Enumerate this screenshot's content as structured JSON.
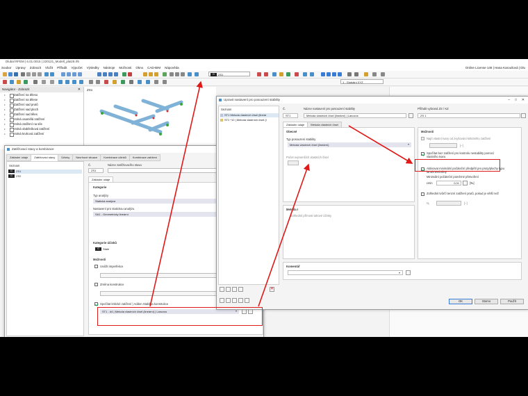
{
  "app": {
    "title": "Dlubal RFEM | 6.01.0015 | 220121_Modell_platz8.rf6",
    "license": "Online License 146 | Hana Karoušová | Dlu",
    "menu": [
      "Soubor",
      "Úpravy",
      "Zobrazit",
      "Vložit",
      "Přiřadit",
      "Výpočet",
      "Výsledky",
      "Nástroje",
      "Možnosti",
      "Okno",
      "CAD-BIM",
      "Nápověda"
    ],
    "toolbar": {
      "loadcase_swatch": "G",
      "loadcase": "ZS1",
      "coord_system": "1 - Globální XYZ"
    }
  },
  "navigator": {
    "title": "Navigátor - Zobrazit",
    "items": [
      "Zatížení na těleso",
      "Zatížení na tělese",
      "Zatížení sad prutů",
      "Zatížení sad ploch",
      "Zatížení sad těles",
      "Volná osamělá zatížení",
      "Volná zatížení na síle",
      "Volná obdélníková zatížení",
      "Volná kruhová zatížení"
    ]
  },
  "viewport": {
    "label": "ZS1"
  },
  "dlg1": {
    "title": "Zatěžovací stavy a kombinace",
    "tabs": [
      "Základní údaje",
      "Zatěžovací stavy",
      "Účinky",
      "Návrhové situace",
      "Kombinace účinků",
      "Kombinace zatížení"
    ],
    "list_header": "Seznam",
    "list": [
      {
        "tag": "G",
        "name": "ZS1"
      },
      {
        "tag": "G",
        "name": "ZS2"
      }
    ],
    "no_label": "Č.",
    "no_value": "ZS1",
    "name_label": "Název zatěžovacího stavu",
    "subtab": "Základní údaje",
    "category_label": "Kategorie",
    "analysis_type_label": "Typ analýzy",
    "analysis_type": "Statická analýza",
    "static_settings_label": "Nastavení pro statickou analýzu",
    "static_settings": "SA1 - Geometricky lineární",
    "action_category_label": "Kategorie účinků",
    "action_swatch": "G",
    "action_category": "Stálé",
    "options_label": "Možnosti",
    "opt_imperfection": "Uvážit imperfekce",
    "opt_structure_mod": "Změna konstrukce",
    "stability_check": "Spočítat kritické zatížení | Addon Stabilita konstrukce",
    "stability_setting": "ST1 - #4 | Metoda vlastních čísel (lineární) | Lanczos"
  },
  "dlg2": {
    "title": "Upravit nastavení pro posouzení stability",
    "list_header": "Seznam",
    "list": [
      {
        "no": "ST1",
        "name": "Metoda vlastních čísel (lineár"
      },
      {
        "no": "ST2",
        "name": "*10 | Metoda vlastních čísel (l"
      }
    ],
    "no_label": "Č.",
    "no_value": "ST1",
    "name_label": "Název nastavení pro posouzení stability",
    "name_value": "Metoda vlastních čísel (lineární) | Lanczos",
    "assign_label": "Přiřadit vybraná ZS / KZ",
    "assign_value": "ZS 1",
    "tabs": [
      "Základní údaje",
      "Metoda vlastních čísel"
    ],
    "general_label": "Obecné",
    "stability_type_label": "Typ posouzení stability",
    "stability_type": "Metoda vlastních čísel (lineární)",
    "eigen_count_label": "Počet nejmenších vlastních čísel",
    "options_label": "Možnosti",
    "opt_find_factor": "Najít vlastní tvary od zvyšování kritického zatížení",
    "opt_find_factor_unit": "[–]",
    "opt_stiff_calc": "Spočítat bez zatížení pro kontrolu nestability pomocí vlastního tvaru",
    "opt_min_stiff": "Aktivovat minimální počáteční předpětí pro pruty/plochy typu lana/membrány",
    "min_prestress_label": "Minimální počáteční poměrné přetvoření",
    "min_prestress_sym": "εmin",
    "min_prestress_value": "0,01",
    "min_prestress_unit": "[‰]",
    "opt_tension": "Zohlednit tvůrčí tenzní zatížení prutů, pokud je větší než",
    "tension_sym": "N₁",
    "tension_unit": "[–]",
    "method_label": "Metoda I",
    "method_value": "Zohlednit přímost tahové účinky",
    "comment_label": "Komentář",
    "ok": "OK",
    "cancel": "Storno",
    "apply": "Použít"
  }
}
